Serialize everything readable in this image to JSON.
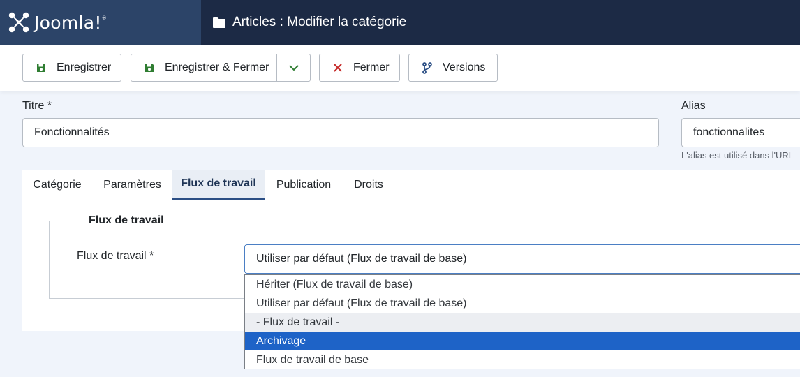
{
  "header": {
    "logo_text": "Joomla!",
    "logo_sup": "®",
    "title": "Articles : Modifier la catégorie"
  },
  "toolbar": {
    "save_label": "Enregistrer",
    "save_close_label": "Enregistrer & Fermer",
    "close_label": "Fermer",
    "versions_label": "Versions"
  },
  "form": {
    "title_label": "Titre *",
    "title_value": "Fonctionnalités",
    "alias_label": "Alias",
    "alias_value": "fonctionnalites",
    "alias_hint": "L'alias est utilisé dans l'URL"
  },
  "tabs": [
    {
      "label": "Catégorie",
      "active": false
    },
    {
      "label": "Paramètres",
      "active": false
    },
    {
      "label": "Flux de travail",
      "active": true
    },
    {
      "label": "Publication",
      "active": false
    },
    {
      "label": "Droits",
      "active": false
    }
  ],
  "workflow": {
    "legend": "Flux de travail",
    "field_label": "Flux de travail *",
    "selected_value": "Utiliser par défaut (Flux de travail de base)",
    "options": [
      {
        "label": "Hériter (Flux de travail de base)",
        "type": "option"
      },
      {
        "label": "Utiliser par défaut (Flux de travail de base)",
        "type": "option"
      },
      {
        "label": "- Flux de travail -",
        "type": "group"
      },
      {
        "label": "Archivage",
        "type": "highlighted"
      },
      {
        "label": "Flux de travail de base",
        "type": "option"
      }
    ]
  },
  "colors": {
    "header_bg": "#1c2a45",
    "logo_bg": "#2c4468",
    "save_icon": "#2f7d32",
    "close_icon": "#c52827",
    "versions_icon": "#2c4f85",
    "highlight": "#1e63c7"
  },
  "icons": {
    "logo": "joomla-logo-icon",
    "folder": "folder-icon",
    "save": "save-icon",
    "dropdown": "chevron-down-icon",
    "close": "close-icon",
    "versions": "branch-icon"
  }
}
